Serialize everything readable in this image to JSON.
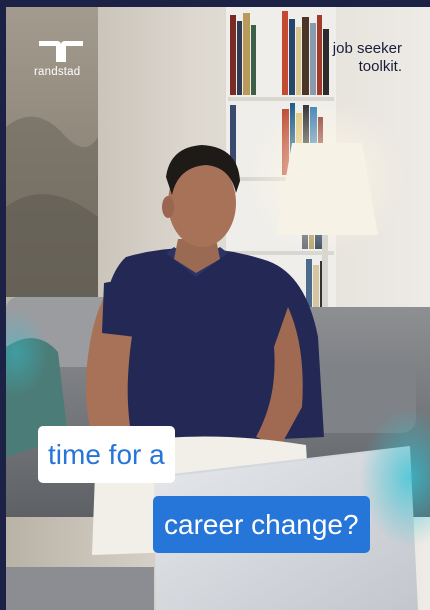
{
  "brand": {
    "name": "randstad",
    "mark_icon": "randstad-logo-mark",
    "color_dark": "#1b2246",
    "color_blue": "#2675d8"
  },
  "toolkit": {
    "line1": "job seeker",
    "line2": "toolkit."
  },
  "headline": {
    "line1": "time for a",
    "line2": "career change?"
  }
}
